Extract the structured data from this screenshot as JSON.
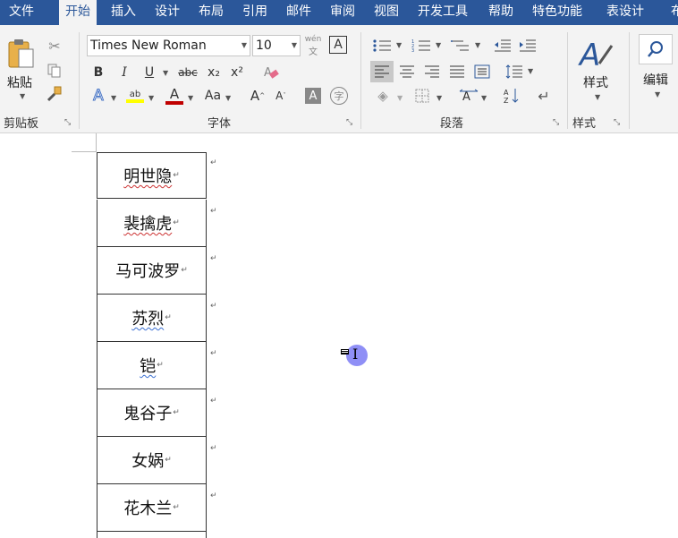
{
  "tabs": [
    {
      "label": "文件",
      "active": false
    },
    {
      "label": "开始",
      "active": true
    },
    {
      "label": "插入",
      "active": false
    },
    {
      "label": "设计",
      "active": false
    },
    {
      "label": "布局",
      "active": false
    },
    {
      "label": "引用",
      "active": false
    },
    {
      "label": "邮件",
      "active": false
    },
    {
      "label": "审阅",
      "active": false
    },
    {
      "label": "视图",
      "active": false
    },
    {
      "label": "开发工具",
      "active": false
    },
    {
      "label": "帮助",
      "active": false
    },
    {
      "label": "特色功能",
      "active": false
    },
    {
      "label": "表设计",
      "active": false
    },
    {
      "label": "布",
      "active": false
    }
  ],
  "ribbon": {
    "clipboard": {
      "group_label": "剪贴板",
      "paste_label": "粘贴"
    },
    "font": {
      "group_label": "字体",
      "font_name": "Times New Roman",
      "font_size": "10",
      "bold": "B",
      "italic": "I",
      "underline": "U",
      "strike": "abc",
      "subscript": "x₂",
      "superscript": "x²",
      "case": "Aa",
      "grow": "A",
      "shrink": "A",
      "phonetic": "wén",
      "highlight_color": "#ffff00",
      "font_color": "#c00000"
    },
    "paragraph": {
      "group_label": "段落"
    },
    "styles": {
      "group_label": "样式",
      "styles_label": "样式"
    },
    "editing": {
      "editing_label": "编辑"
    }
  },
  "document": {
    "rows": [
      {
        "text": "明世隐",
        "squiggle": "red"
      },
      {
        "text": "裴擒虎",
        "squiggle": "red"
      },
      {
        "text": "马可波罗",
        "squiggle": ""
      },
      {
        "text": "苏烈",
        "squiggle": "blue"
      },
      {
        "text": "铠",
        "squiggle": "blue"
      },
      {
        "text": "鬼谷子",
        "squiggle": ""
      },
      {
        "text": "女娲",
        "squiggle": ""
      },
      {
        "text": "花木兰",
        "squiggle": ""
      }
    ],
    "paragraph_mark": "↵"
  },
  "colors": {
    "accent": "#2b579a",
    "ribbon_bg": "#f3f3f3",
    "cursor": "#7b7bf5"
  }
}
